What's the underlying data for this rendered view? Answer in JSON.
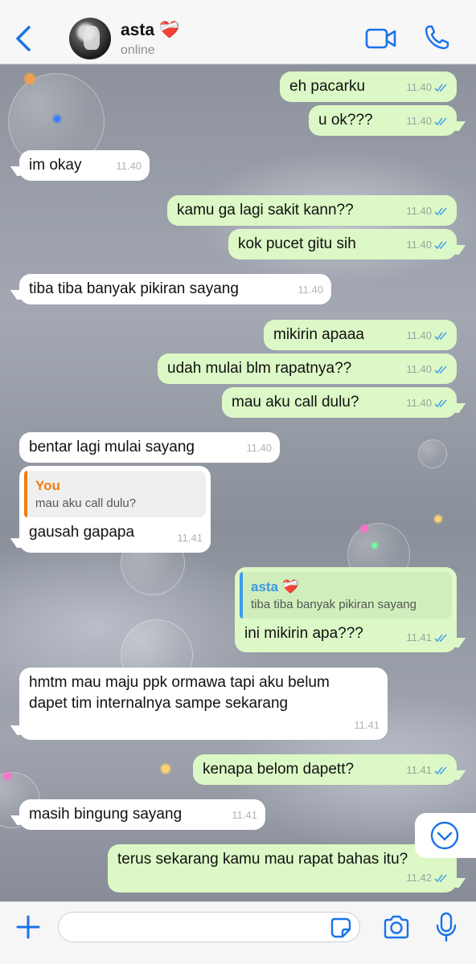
{
  "header": {
    "back_label": "Back",
    "contact_name": "asta ❤️‍🩹",
    "status": "online",
    "icons": [
      "chevron-left-icon",
      "video-call-icon",
      "phone-icon"
    ]
  },
  "messages": [
    {
      "dir": "out",
      "text": "eh pacarku",
      "time": "11.40"
    },
    {
      "dir": "out",
      "text": "u ok???",
      "time": "11.40"
    },
    {
      "dir": "in",
      "text": "im okay",
      "time": "11.40"
    },
    {
      "dir": "out",
      "text": "kamu ga lagi sakit kann??",
      "time": "11.40"
    },
    {
      "dir": "out",
      "text": "kok pucet gitu sih",
      "time": "11.40"
    },
    {
      "dir": "in",
      "text": "tiba tiba banyak pikiran sayang",
      "time": "11.40"
    },
    {
      "dir": "out",
      "text": "mikirin apaaa",
      "time": "11.40"
    },
    {
      "dir": "out",
      "text": "udah mulai blm rapatnya??",
      "time": "11.40"
    },
    {
      "dir": "out",
      "text": "mau aku call dulu?",
      "time": "11.40"
    },
    {
      "dir": "in",
      "text": "bentar lagi mulai sayang",
      "time": "11.40"
    },
    {
      "dir": "in",
      "text": "gausah gapapa",
      "time": "11.41",
      "quote": {
        "author": "You",
        "text": "mau aku call dulu?"
      }
    },
    {
      "dir": "out",
      "text": "ini mikirin apa???",
      "time": "11.41",
      "quote": {
        "author": "asta ❤️‍🩹",
        "text": "tiba tiba banyak pikiran sayang"
      }
    },
    {
      "dir": "in",
      "text_line1": "hmtm mau maju ppk ormawa tapi aku belum",
      "text_line2": "dapet tim internalnya sampe sekarang",
      "time": "11.41"
    },
    {
      "dir": "out",
      "text": "kenapa belom dapett?",
      "time": "11.41"
    },
    {
      "dir": "in",
      "text": "masih bingung sayang",
      "time": "11.41"
    },
    {
      "dir": "out",
      "text": "terus sekarang kamu mau rapat bahas itu?",
      "time": "11.42"
    }
  ],
  "input": {
    "placeholder": "",
    "value": ""
  },
  "colors": {
    "accent": "#1a73e8",
    "outgoing": "#dcf8c6",
    "incoming": "#ffffff",
    "read_ticks": "#4fa3e6"
  }
}
